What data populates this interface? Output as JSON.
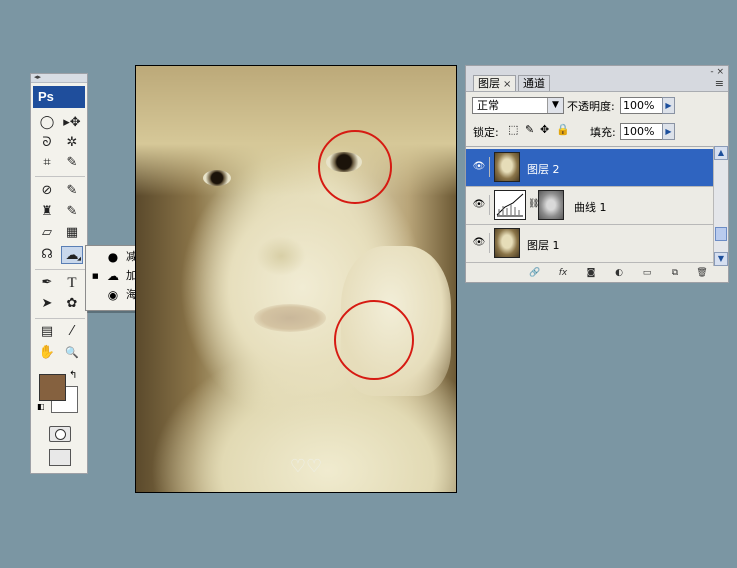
{
  "toolbox": {
    "logo": "Ps",
    "tools": {
      "marquee": "◯",
      "move": "▸✥",
      "lasso": "ᘐ",
      "magic_wand": "✲",
      "crop": "⌗",
      "slice": "✎",
      "heal": "⊘",
      "brush": "✎",
      "stamp": "♜",
      "history_brush": "✎",
      "eraser": "▱",
      "gradient": "▦",
      "blur": "☊",
      "dodge_burn": "☁",
      "pen": "✒",
      "type": "T",
      "path_select": "➤",
      "shape": "✿",
      "notes": "▤",
      "eyedropper": "⁄",
      "hand": "✋",
      "zoom": "🔍"
    }
  },
  "flyout": {
    "items": [
      {
        "mark": "",
        "icon": "●",
        "label": "减淡工具",
        "key": "O"
      },
      {
        "mark": "■",
        "icon": "☁",
        "label": "加深工具",
        "key": "O"
      },
      {
        "mark": "",
        "icon": "◉",
        "label": "海绵工具",
        "key": "O"
      }
    ]
  },
  "layers_panel": {
    "tabs": [
      {
        "label": "图层",
        "close": "×"
      },
      {
        "label": "通道"
      }
    ],
    "window_controls": "- ×",
    "menu_icon": "≡",
    "blend_mode": "正常",
    "opacity_label": "不透明度:",
    "opacity_value": "100%",
    "lock_label": "锁定:",
    "fill_label": "填充:",
    "fill_value": "100%",
    "layers": [
      {
        "name": "图层 2",
        "selected": true,
        "visible_icon": "👁"
      },
      {
        "name": "曲线 1",
        "selected": false,
        "visible_icon": "👁"
      },
      {
        "name": "图层 1",
        "selected": false,
        "visible_icon": "👁"
      }
    ],
    "footer_icons": [
      "🔗",
      "fx",
      "◙",
      "◐",
      "▭",
      "⧉",
      "🗑"
    ]
  },
  "colors": {
    "foreground": "#85613f",
    "background": "#ffffff",
    "selection": "#2f64c0",
    "annotation_circles": "#d61a12",
    "desktop": "#7b96a3"
  }
}
